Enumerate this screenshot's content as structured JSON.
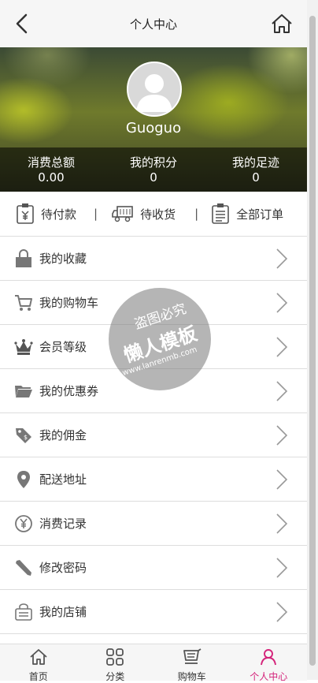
{
  "header": {
    "title": "个人中心",
    "back_icon": "chevron-left-icon",
    "home_icon": "home-icon"
  },
  "profile": {
    "username": "Guoguo"
  },
  "stats": [
    {
      "label": "消费总额",
      "value": "0.00"
    },
    {
      "label": "我的积分",
      "value": "0"
    },
    {
      "label": "我的足迹",
      "value": "0"
    }
  ],
  "orders": [
    {
      "label": "待付款",
      "icon": "yen-clipboard-icon"
    },
    {
      "label": "待收货",
      "icon": "truck-icon"
    },
    {
      "label": "全部订单",
      "icon": "list-clipboard-icon"
    }
  ],
  "order_separator": "|",
  "menu": [
    {
      "label": "我的收藏",
      "icon": "bag-icon"
    },
    {
      "label": "我的购物车",
      "icon": "cart-icon"
    },
    {
      "label": "会员等级",
      "icon": "crown-icon"
    },
    {
      "label": "我的优惠券",
      "icon": "folder-icon"
    },
    {
      "label": "我的佣金",
      "icon": "tag-icon"
    },
    {
      "label": "配送地址",
      "icon": "location-pin-icon"
    },
    {
      "label": "消费记录",
      "icon": "yen-circle-icon"
    },
    {
      "label": "修改密码",
      "icon": "pencil-icon"
    },
    {
      "label": "我的店铺",
      "icon": "shop-icon"
    }
  ],
  "tabs": [
    {
      "label": "首页",
      "icon": "home-icon"
    },
    {
      "label": "分类",
      "icon": "grid-icon"
    },
    {
      "label": "购物车",
      "icon": "cart-list-icon"
    },
    {
      "label": "个人中心",
      "icon": "person-icon"
    }
  ],
  "watermark": {
    "line1": "盗图必究",
    "line2": "懒人模板",
    "line3": "www.lanrenmb.com"
  },
  "colors": {
    "accent": "#d4237a",
    "icon_gray": "#777777",
    "divider": "#dddddd"
  }
}
